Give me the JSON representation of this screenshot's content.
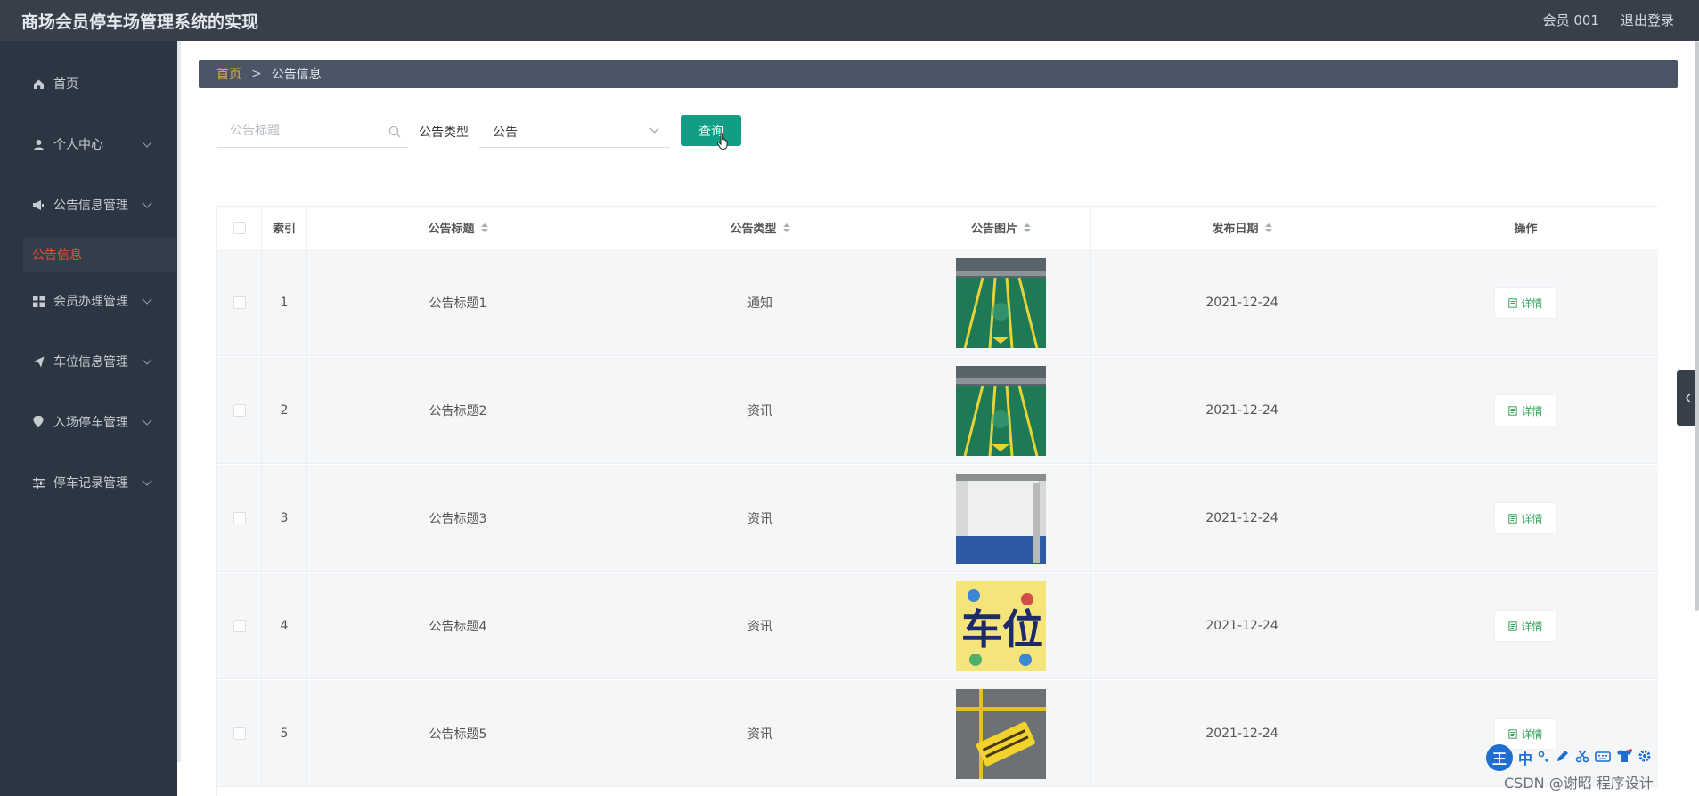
{
  "app": {
    "title": "商场会员停车场管理系统的实现"
  },
  "header": {
    "user": "会员 001",
    "logout": "退出登录"
  },
  "sidebar": {
    "items": [
      {
        "label": "首页",
        "icon": "home-icon"
      },
      {
        "label": "个人中心",
        "icon": "user-icon"
      },
      {
        "label": "公告信息管理",
        "icon": "megaphone-icon"
      },
      {
        "label": "会员办理管理",
        "icon": "grid-icon"
      },
      {
        "label": "车位信息管理",
        "icon": "send-icon"
      },
      {
        "label": "入场停车管理",
        "icon": "location-icon"
      },
      {
        "label": "停车记录管理",
        "icon": "sliders-icon"
      }
    ],
    "active_sub": "公告信息"
  },
  "breadcrumb": {
    "home": "首页",
    "separator": ">",
    "current": "公告信息"
  },
  "filters": {
    "search_placeholder": "公告标题",
    "type_label": "公告类型",
    "type_value": "公告",
    "query_button": "查询"
  },
  "table": {
    "columns": [
      "索引",
      "公告标题",
      "公告类型",
      "公告图片",
      "发布日期",
      "操作"
    ],
    "rows": [
      {
        "index": "1",
        "title": "公告标题1",
        "type": "通知",
        "image": "green-parking-lot",
        "date": "2021-12-24",
        "action": "详情"
      },
      {
        "index": "2",
        "title": "公告标题2",
        "type": "资讯",
        "image": "green-parking-lot",
        "date": "2021-12-24",
        "action": "详情"
      },
      {
        "index": "3",
        "title": "公告标题3",
        "type": "资讯",
        "image": "garage-wall",
        "date": "2021-12-24",
        "action": "详情"
      },
      {
        "index": "4",
        "title": "公告标题4",
        "type": "资讯",
        "image": "parking-sign",
        "date": "2021-12-24",
        "action": "详情"
      },
      {
        "index": "5",
        "title": "公告标题5",
        "type": "资讯",
        "image": "floor-marking",
        "date": "2021-12-24",
        "action": "详情"
      }
    ]
  },
  "ime": {
    "logo": "王",
    "mode": "中"
  },
  "watermark": "CSDN @谢昭  程序设计",
  "colors": {
    "topbar": "#373f4a",
    "sidebar": "#2c3542",
    "accent": "#109e85",
    "active": "#e0502e",
    "breadcrumb_home": "#e7a743"
  }
}
